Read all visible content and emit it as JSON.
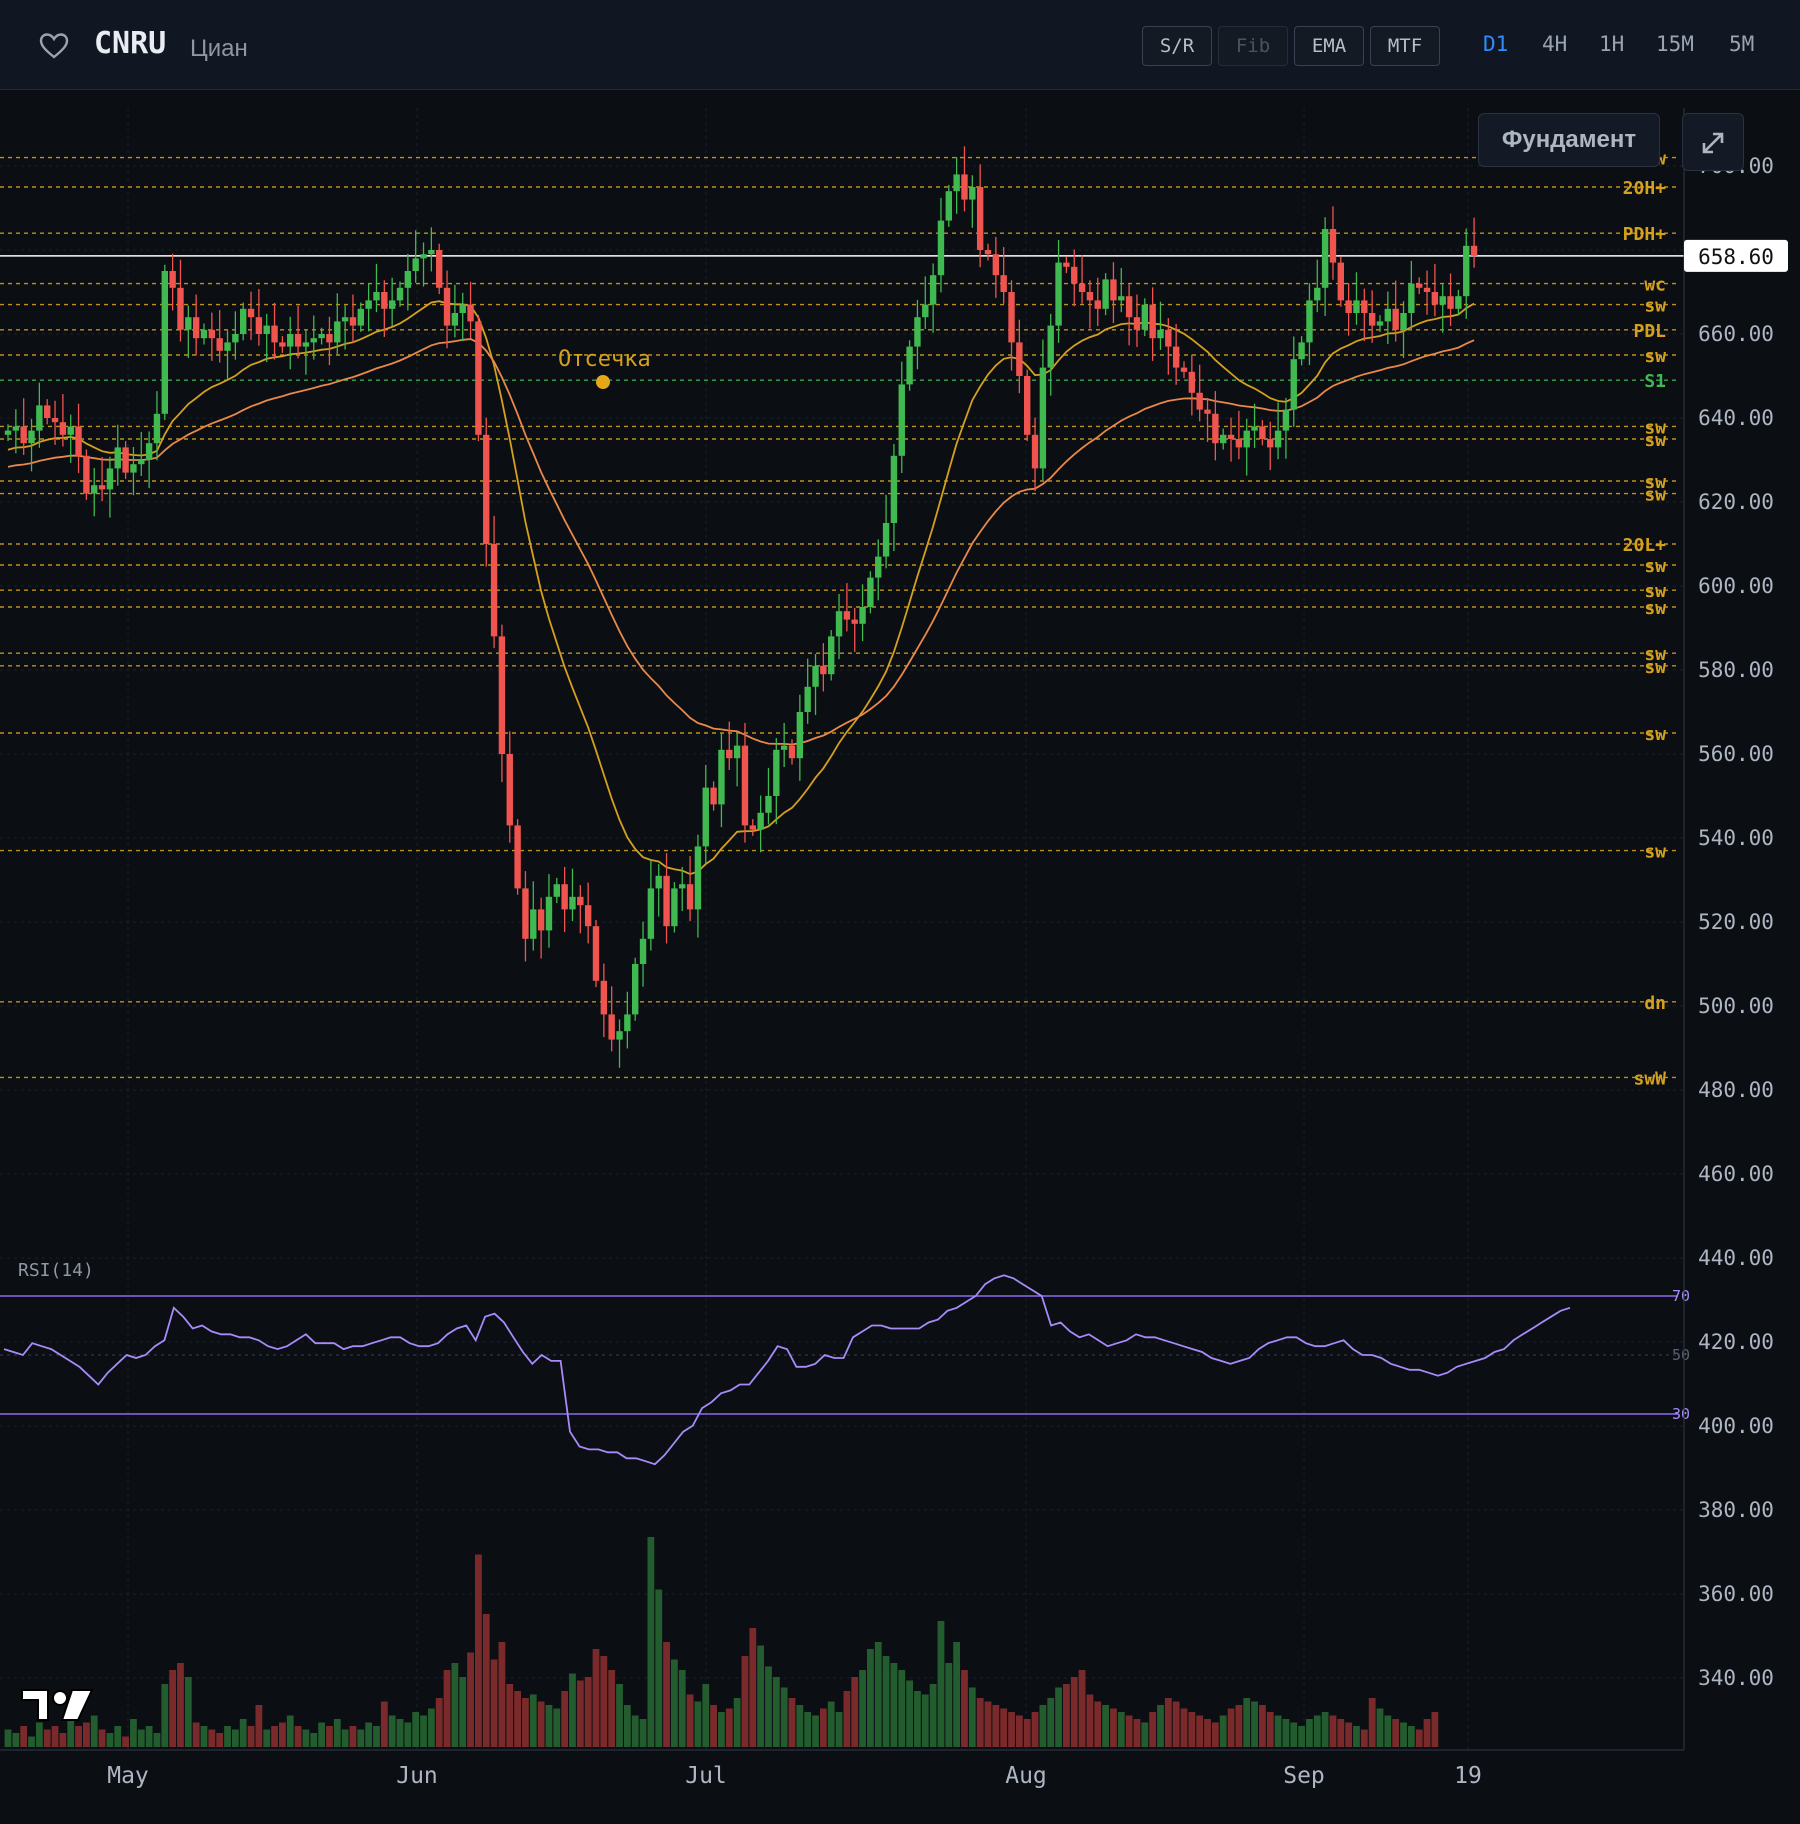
{
  "header": {
    "ticker": "CNRU",
    "company": "Циан",
    "tools": [
      {
        "label": "S/R",
        "enabled": true
      },
      {
        "label": "Fib",
        "enabled": false
      },
      {
        "label": "EMA",
        "enabled": true
      },
      {
        "label": "MTF",
        "enabled": true
      }
    ],
    "timeframes": [
      {
        "label": "D1",
        "active": true
      },
      {
        "label": "4H",
        "active": false
      },
      {
        "label": "1H",
        "active": false
      },
      {
        "label": "15M",
        "active": false
      },
      {
        "label": "5M",
        "active": false
      }
    ]
  },
  "fundament_label": "Фундамент",
  "rsi_label": "RSI(14)",
  "annotation_label": "Отсечка",
  "colors": {
    "up": "#3fb950",
    "down": "#f0544f",
    "level": "#d4a01e",
    "ema_fast": "#d4a01e",
    "ema_slow": "#e8894a",
    "rsi": "#a78bfa",
    "current_line": "#ffffff"
  },
  "chart_data": {
    "type": "candlestick",
    "y_axis_ticks": [
      "700.00",
      "680.00",
      "660.00",
      "640.00",
      "620.00",
      "600.00",
      "580.00",
      "560.00",
      "540.00",
      "520.00",
      "500.00",
      "480.00",
      "460.00",
      "440.00",
      "420.00",
      "400.00",
      "380.00",
      "360.00",
      "340.00"
    ],
    "x_axis_labels": [
      "May",
      "Jun",
      "Jul",
      "Aug",
      "Sep",
      "19"
    ],
    "current_price": "658.60",
    "current_price_value": 658.6,
    "levels": [
      {
        "label": "sw",
        "value": 682,
        "color": "#d4a01e"
      },
      {
        "label": "20H+",
        "value": 675,
        "color": "#d4a01e"
      },
      {
        "label": "PDH+",
        "value": 664,
        "color": "#d4a01e"
      },
      {
        "label": "wc",
        "value": 652,
        "color": "#d4a01e"
      },
      {
        "label": "sw",
        "value": 647,
        "color": "#d4a01e"
      },
      {
        "label": "PDL",
        "value": 641,
        "color": "#d4a01e"
      },
      {
        "label": "sw",
        "value": 635,
        "color": "#d4a01e"
      },
      {
        "label": "S1",
        "value": 629,
        "color": "#3fb950"
      },
      {
        "label": "sw",
        "value": 618,
        "color": "#d4a01e"
      },
      {
        "label": "sw",
        "value": 615,
        "color": "#d4a01e"
      },
      {
        "label": "sw",
        "value": 605,
        "color": "#d4a01e"
      },
      {
        "label": "sw",
        "value": 602,
        "color": "#d4a01e"
      },
      {
        "label": "20L+",
        "value": 590,
        "color": "#d4a01e"
      },
      {
        "label": "sw",
        "value": 585,
        "color": "#d4a01e"
      },
      {
        "label": "sw",
        "value": 579,
        "color": "#d4a01e"
      },
      {
        "label": "sw",
        "value": 575,
        "color": "#d4a01e"
      },
      {
        "label": "sw",
        "value": 564,
        "color": "#d4a01e"
      },
      {
        "label": "sw",
        "value": 561,
        "color": "#d4a01e"
      },
      {
        "label": "sw",
        "value": 545,
        "color": "#d4a01e"
      },
      {
        "label": "sw",
        "value": 517,
        "color": "#d4a01e"
      },
      {
        "label": "dn",
        "value": 481,
        "color": "#d4a01e"
      },
      {
        "label": "swW",
        "value": 463,
        "color": "#d4a01e"
      }
    ],
    "closes": [
      617,
      618,
      614,
      617,
      623,
      620,
      619,
      616,
      618,
      611,
      602,
      604,
      603,
      608,
      613,
      607,
      609,
      610,
      614,
      621,
      655,
      651,
      641,
      644,
      639,
      641,
      639,
      636,
      638,
      640,
      646,
      644,
      640,
      642,
      638,
      637,
      640,
      637,
      638,
      639,
      640,
      638,
      643,
      644,
      642,
      646,
      648,
      650,
      646,
      648,
      651,
      655,
      658,
      659,
      660,
      651,
      642,
      645,
      647,
      643,
      616,
      590,
      568,
      540,
      523,
      508,
      496,
      503,
      498,
      506,
      509,
      503,
      506,
      504,
      499,
      486,
      478,
      472,
      474,
      478,
      490,
      496,
      508,
      511,
      499,
      508,
      509,
      503,
      518,
      532,
      528,
      541,
      539,
      542,
      523,
      522,
      526,
      530,
      541,
      542,
      539,
      550,
      556,
      561,
      559,
      568,
      574,
      572,
      571,
      575,
      582,
      587,
      595,
      611,
      628,
      637,
      644,
      647,
      654,
      667,
      674,
      678,
      672,
      675,
      660,
      659,
      654,
      650,
      638,
      630,
      616,
      608,
      632,
      642,
      657,
      656,
      652,
      650,
      648,
      646,
      653,
      648,
      649,
      644,
      641,
      647,
      639,
      641,
      637,
      632,
      631,
      626,
      622,
      621,
      614,
      616,
      615,
      613,
      617,
      618,
      615,
      613,
      617,
      622,
      634,
      638,
      648,
      651,
      665,
      657,
      648,
      645,
      648,
      645,
      642,
      643,
      646,
      641,
      645,
      652,
      651,
      650,
      647,
      649,
      646,
      649,
      661,
      658.6
    ],
    "rsi": [
      52,
      51,
      50,
      54,
      53,
      52,
      50,
      48,
      46,
      43,
      40,
      44,
      47,
      50,
      49,
      50,
      53,
      55,
      66,
      63,
      59,
      60,
      58,
      57,
      57,
      56,
      56,
      55,
      53,
      52,
      53,
      55,
      57,
      54,
      54,
      54,
      52,
      53,
      53,
      54,
      55,
      56,
      56,
      54,
      53,
      53,
      54,
      57,
      59,
      60,
      55,
      63,
      64,
      61,
      56,
      51,
      47,
      50,
      48,
      48,
      24,
      19,
      18,
      18,
      17,
      17,
      15,
      15,
      14,
      13,
      16,
      20,
      24,
      26,
      32,
      34,
      37,
      38,
      40,
      40,
      44,
      48,
      53,
      52,
      46,
      46,
      47,
      50,
      49,
      49,
      56,
      58,
      60,
      60,
      59,
      59,
      59,
      59,
      61,
      62,
      65,
      66,
      68,
      70,
      74,
      76,
      77,
      76,
      74,
      72,
      70,
      60,
      61,
      58,
      56,
      57,
      55,
      53,
      54,
      55,
      57,
      56,
      56,
      55,
      54,
      53,
      52,
      51,
      49,
      48,
      47,
      48,
      49,
      52,
      54,
      55,
      56,
      56,
      54,
      53,
      53,
      54,
      55,
      52,
      50,
      50,
      49,
      47,
      46,
      45,
      45,
      44,
      43,
      44,
      46,
      47,
      48,
      49,
      51,
      52,
      55,
      57,
      59,
      61,
      63,
      65,
      66
    ],
    "volume": [
      5,
      4,
      6,
      3,
      7,
      5,
      6,
      4,
      8,
      6,
      7,
      9,
      5,
      4,
      6,
      3,
      8,
      5,
      6,
      4,
      18,
      22,
      24,
      20,
      7,
      6,
      5,
      4,
      6,
      5,
      8,
      6,
      12,
      5,
      6,
      7,
      9,
      6,
      5,
      4,
      7,
      6,
      8,
      5,
      6,
      5,
      7,
      6,
      13,
      9,
      8,
      7,
      10,
      9,
      11,
      14,
      22,
      24,
      20,
      27,
      55,
      38,
      25,
      30,
      18,
      16,
      14,
      15,
      13,
      12,
      11,
      16,
      21,
      19,
      20,
      28,
      26,
      22,
      18,
      12,
      9,
      8,
      60,
      45,
      30,
      25,
      22,
      15,
      13,
      18,
      12,
      10,
      11,
      14,
      26,
      34,
      29,
      23,
      20,
      17,
      14,
      12,
      10,
      9,
      11,
      13,
      10,
      16,
      20,
      22,
      28,
      30,
      26,
      24,
      22,
      19,
      16,
      15,
      18,
      36,
      24,
      30,
      22,
      17,
      14,
      13,
      12,
      11,
      10,
      9,
      8,
      10,
      12,
      14,
      17,
      18,
      20,
      22,
      15,
      13,
      12,
      11,
      10,
      9,
      8,
      7,
      10,
      12,
      14,
      13,
      11,
      10,
      9,
      8,
      7,
      9,
      11,
      12,
      14,
      13,
      12,
      10,
      9,
      8,
      7,
      6,
      8,
      9,
      10,
      9,
      8,
      7,
      6,
      5,
      14,
      11,
      9,
      8,
      7,
      6,
      5,
      8,
      10
    ]
  }
}
